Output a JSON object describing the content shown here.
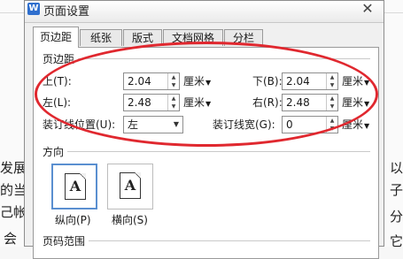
{
  "document": {
    "left_fragments": [
      "发展",
      "的当",
      "己帐",
      "会"
    ],
    "right_fragments": [
      "以",
      "子",
      "分",
      "它"
    ]
  },
  "dialog": {
    "title": "页面设置",
    "close_symbol": "✕",
    "app_icon": "W",
    "tabs": [
      "页边距",
      "纸张",
      "版式",
      "文档网格",
      "分栏"
    ],
    "margins": {
      "section_label": "页边距",
      "top": {
        "label": "上(T):",
        "value": "2.04",
        "unit": "厘米"
      },
      "bottom": {
        "label": "下(B):",
        "value": "2.04",
        "unit": "厘米"
      },
      "left": {
        "label": "左(L):",
        "value": "2.48",
        "unit": "厘米"
      },
      "right": {
        "label": "右(R):",
        "value": "2.48",
        "unit": "厘米"
      },
      "gutter_pos": {
        "label": "装订线位置(U):",
        "value": "左"
      },
      "gutter_width": {
        "label": "装订线宽(G):",
        "value": "0",
        "unit": "厘米"
      }
    },
    "orientation": {
      "section_label": "方向",
      "portrait_label": "纵向(P)",
      "landscape_label": "横向(S)",
      "glyph": "A",
      "selected": "portrait"
    },
    "page_range": {
      "section_label": "页码范围"
    }
  },
  "annotation": {
    "color": "#e0282f",
    "shape": "ellipse"
  },
  "colors": {
    "accent": "#5a8fd0",
    "app_icon": "#2f6fce"
  }
}
